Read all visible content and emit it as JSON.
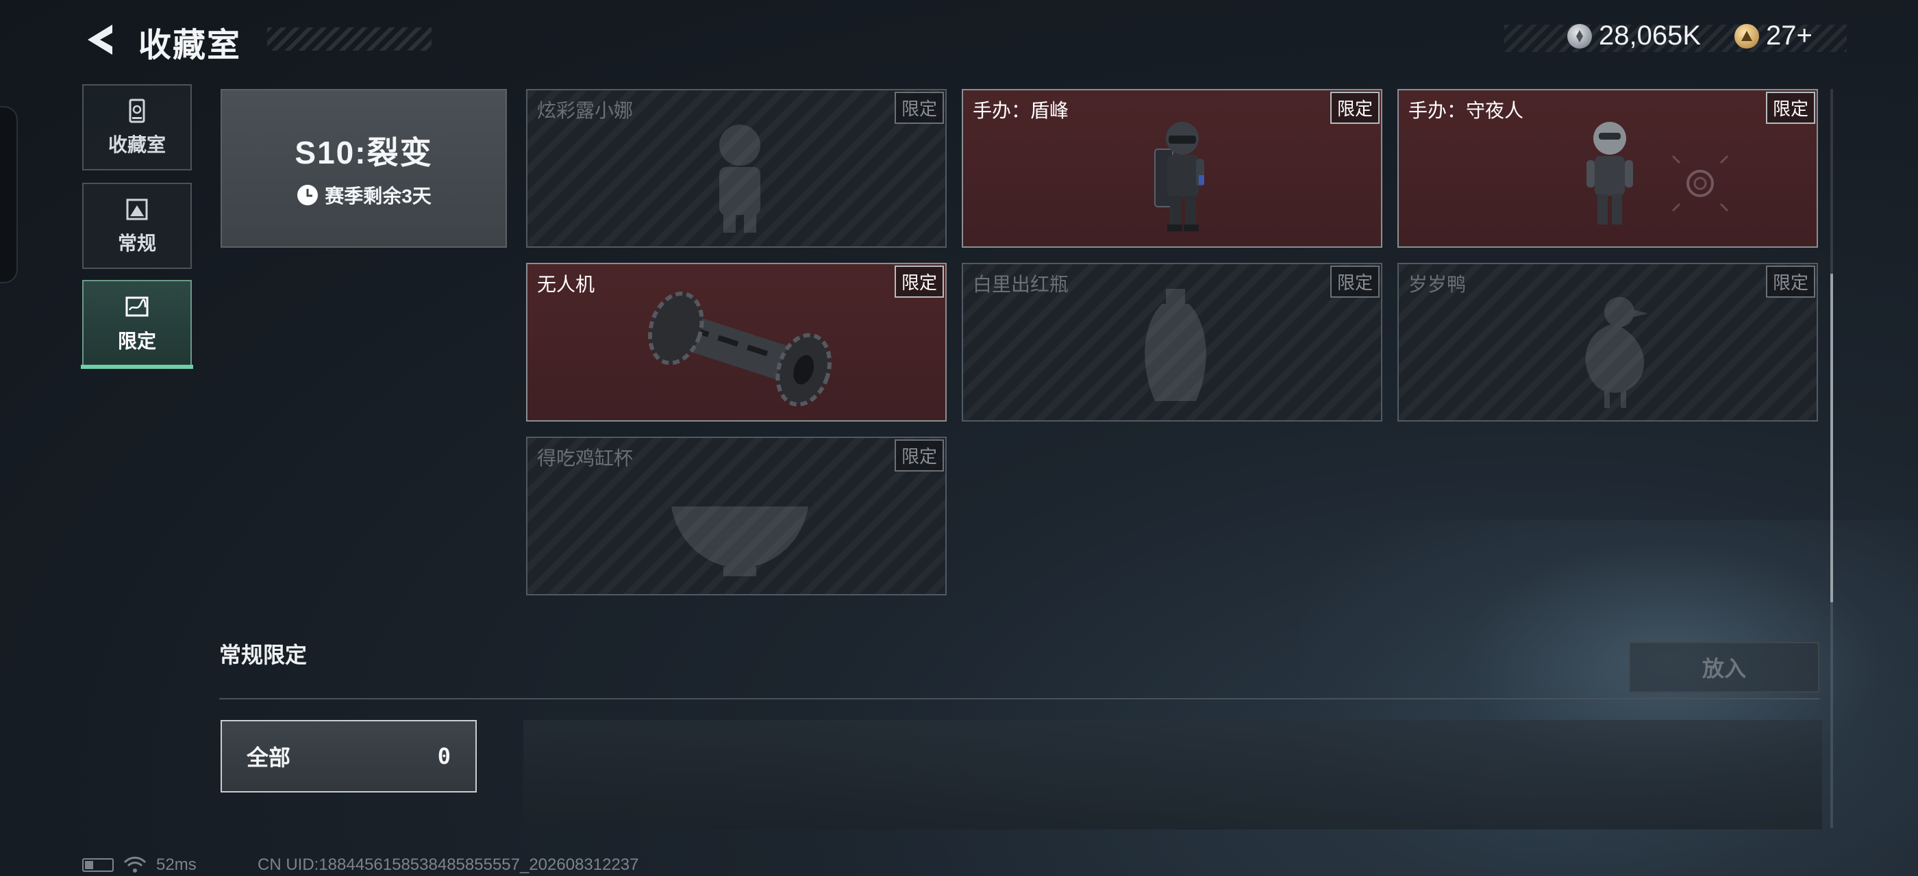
{
  "header": {
    "title": "收藏室"
  },
  "currency": [
    {
      "icon": "silver-coin-icon",
      "value": "28,065K"
    },
    {
      "icon": "gold-token-icon",
      "value": "27+"
    }
  ],
  "sidebar": {
    "items": [
      {
        "label": "收藏室",
        "icon": "collection-cabinet-icon",
        "active": false
      },
      {
        "label": "常规",
        "icon": "framed-picture-icon",
        "active": false
      },
      {
        "label": "限定",
        "icon": "limited-map-icon",
        "active": true
      }
    ]
  },
  "season": {
    "name": "S10:裂变",
    "time_left": "赛季剩余3天"
  },
  "items": [
    {
      "name": "炫彩露小娜",
      "badge": "限定",
      "owned": false
    },
    {
      "name": "手办：盾峰",
      "badge": "限定",
      "owned": true
    },
    {
      "name": "手办：守夜人",
      "badge": "限定",
      "owned": true
    },
    {
      "name": "无人机",
      "badge": "限定",
      "owned": true
    },
    {
      "name": "白里出红瓶",
      "badge": "限定",
      "owned": false
    },
    {
      "name": "岁岁鸭",
      "badge": "限定",
      "owned": false
    },
    {
      "name": "得吃鸡缸杯",
      "badge": "限定",
      "owned": false
    }
  ],
  "section": {
    "title": "常规限定",
    "place_button": "放入",
    "filter": {
      "label": "全部",
      "count": "0"
    }
  },
  "status": {
    "ping": "52ms",
    "uid": "CN UID:1884456158538485855557_202608312237"
  },
  "colors": {
    "owned_card": "#4a2528",
    "active_tab_accent": "#6fd0a8"
  }
}
